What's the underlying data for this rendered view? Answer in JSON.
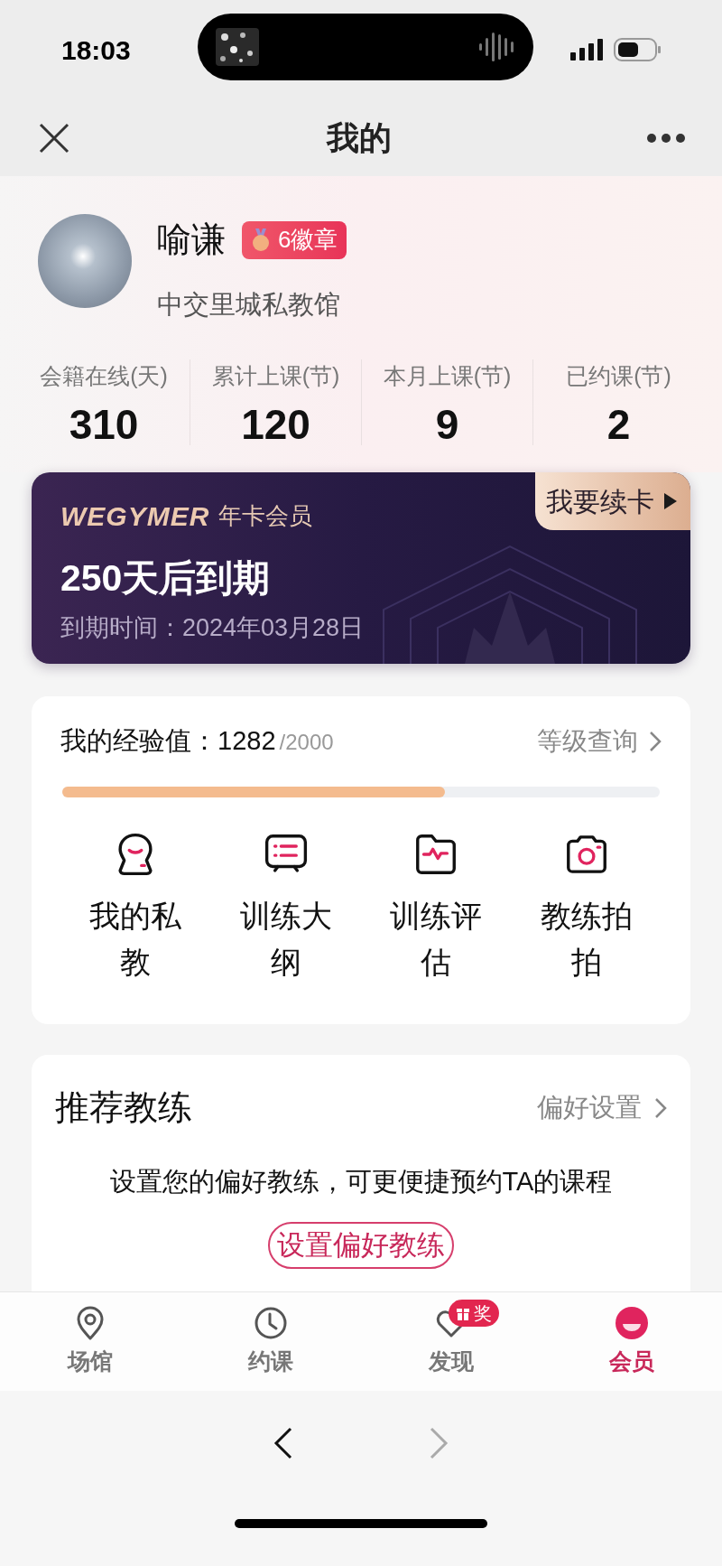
{
  "status_bar": {
    "time": "18:03"
  },
  "nav": {
    "title": "我的"
  },
  "profile": {
    "name": "喻谦",
    "badge": "6徽章",
    "gym": "中交里城私教馆"
  },
  "stats": [
    {
      "label": "会籍在线(天)",
      "value": "310"
    },
    {
      "label": "累计上课(节)",
      "value": "120"
    },
    {
      "label": "本月上课(节)",
      "value": "9"
    },
    {
      "label": "已约课(节)",
      "value": "2"
    }
  ],
  "membership": {
    "brand": "WEGYMER",
    "tier": "年卡会员",
    "renew": "我要续卡",
    "remaining": "250天后到期",
    "expiry_label": "到期时间：",
    "expiry": "2024年03月28日"
  },
  "experience": {
    "label": "我的经验值：",
    "value": "1282",
    "max": "/2000",
    "link": "等级查询",
    "level": 0.64
  },
  "shortcuts": [
    {
      "label": "我的私教",
      "kind": "coach"
    },
    {
      "label": "训练大纲",
      "kind": "syllabus"
    },
    {
      "label": "训练评估",
      "kind": "assessment"
    },
    {
      "label": "教练拍拍",
      "kind": "camera"
    }
  ],
  "recommend": {
    "title": "推荐教练",
    "link": "偏好设置",
    "hint": "设置您的偏好教练，可更便捷预约TA的课程",
    "button": "设置偏好教练"
  },
  "tabs": [
    {
      "label": "场馆",
      "kind": "venue",
      "selected": false
    },
    {
      "label": "约课",
      "kind": "booking",
      "selected": false
    },
    {
      "label": "发现",
      "kind": "discover",
      "selected": false,
      "badge": "奖"
    },
    {
      "label": "会员",
      "kind": "member",
      "selected": true
    }
  ]
}
